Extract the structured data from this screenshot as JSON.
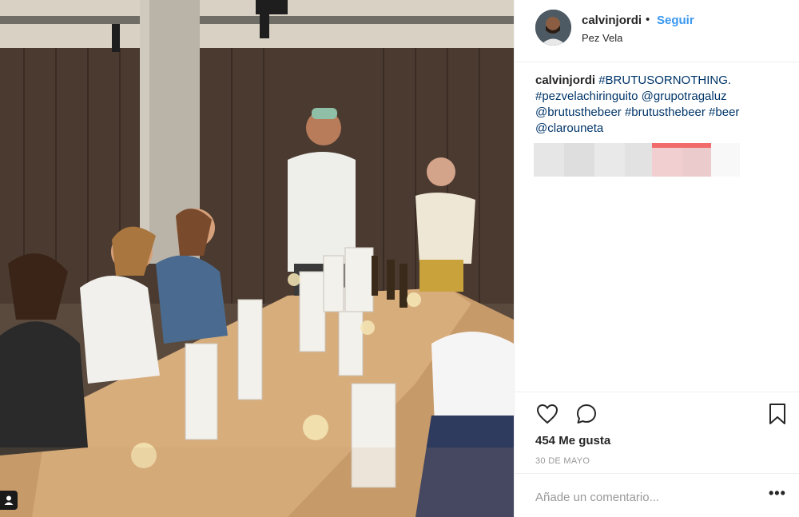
{
  "post": {
    "username": "calvinjordi",
    "dot": "•",
    "follow_label": "Seguir",
    "location": "Pez Vela",
    "caption": {
      "username": "calvinjordi",
      "segments": [
        "#BRUTUSORNOTHING.",
        "#pezvelachiringuito",
        "@grupotragaluz",
        "@brutusthebeer",
        "#brutusthebeer",
        "#beer",
        "@clarouneta"
      ]
    },
    "likes": "454 Me gusta",
    "date": "30 DE MAYO",
    "comment_placeholder": "Añade un comentario...",
    "more_label": "•••"
  },
  "icons": {
    "like": "heart-outline-icon",
    "comment": "speech-bubble-icon",
    "save": "bookmark-icon",
    "user_tag": "person-icon"
  },
  "colors": {
    "link_blue": "#3897f0",
    "hashtag_blue": "#003569",
    "text": "#262626",
    "muted": "#999999",
    "divider": "#efefef"
  }
}
